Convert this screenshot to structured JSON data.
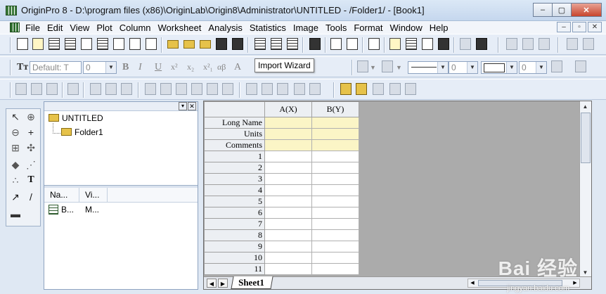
{
  "window": {
    "title": "OriginPro 8 - D:\\program files (x86)\\OriginLab\\Origin8\\Administrator\\UNTITLED - /Folder1/ - [Book1]",
    "controls": [
      "–",
      "▢",
      "✕"
    ]
  },
  "menu": {
    "items": [
      "File",
      "Edit",
      "View",
      "Plot",
      "Column",
      "Worksheet",
      "Analysis",
      "Statistics",
      "Image",
      "Tools",
      "Format",
      "Window",
      "Help"
    ],
    "mdi_controls": [
      "–",
      "▫",
      "✕"
    ]
  },
  "toolbar_format": {
    "font_name": "Default: T",
    "font_size": "0",
    "bold": "B",
    "italic": "I",
    "underline": "U",
    "superscript": "x²",
    "subscript": "x₂",
    "supsub": "x²₁",
    "greek": "αβ",
    "bigger": "A",
    "line_width": "0",
    "pattern_width": "0"
  },
  "tooltip": {
    "text": "Import Wizard"
  },
  "explorer": {
    "tree": [
      {
        "label": "UNTITLED",
        "icon": "folder-icon"
      },
      {
        "label": "Folder1",
        "icon": "folder-icon"
      }
    ],
    "list_headers": [
      "Na...",
      "Vi..."
    ],
    "list_items": [
      {
        "name": "B...",
        "view": "M..."
      }
    ]
  },
  "worksheet": {
    "columns": [
      "A(X)",
      "B(Y)"
    ],
    "meta_rows": [
      "Long Name",
      "Units",
      "Comments"
    ],
    "rows": [
      "1",
      "2",
      "3",
      "4",
      "5",
      "6",
      "7",
      "8",
      "9",
      "10",
      "11"
    ],
    "sheet_tab": "Sheet1"
  },
  "watermark": {
    "brand": "Bai 经验",
    "url": "jingyan.baidu.com"
  },
  "colors": {
    "meta_row_bg": "#fbf5c6",
    "workbook_bg": "#ababab",
    "accent": "#3d7a3d"
  }
}
